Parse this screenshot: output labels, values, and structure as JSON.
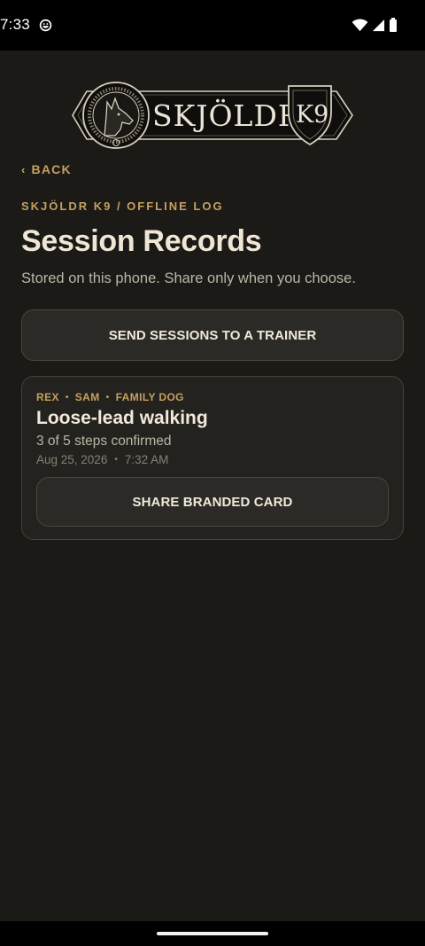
{
  "status_bar": {
    "time": "7:33"
  },
  "logo": {
    "brand": "SKJÖLDR K9"
  },
  "back_label": "BACK",
  "eyebrow": "SKJÖLDR K9 / OFFLINE LOG",
  "title": "Session Records",
  "subtitle": "Stored on this phone. Share only when you choose.",
  "send_button_label": "SEND SESSIONS TO A TRAINER",
  "session": {
    "dog": "REX",
    "handler": "SAM",
    "category": "FAMILY DOG",
    "title": "Loose-lead walking",
    "progress": "3 of 5 steps confirmed",
    "steps_confirmed": 3,
    "steps_total": 5,
    "date": "Aug 25, 2026",
    "time": "7:32 AM",
    "share_label": "SHARE BRANDED CARD"
  },
  "colors": {
    "accent": "#c5a060",
    "background": "#1b1a17",
    "card": "#23221e",
    "button": "#2c2a26"
  }
}
